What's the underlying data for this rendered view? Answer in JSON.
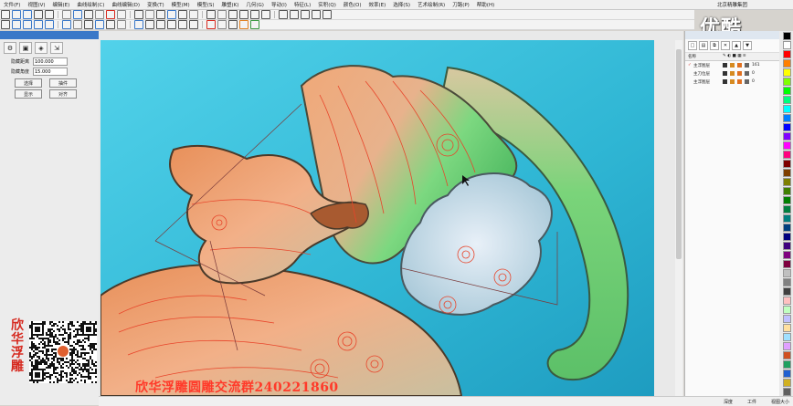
{
  "menu": [
    "文件(F)",
    "视图(V)",
    "编辑(E)",
    "曲线绘制(C)",
    "曲线编辑(D)",
    "变换(T)",
    "模型(M)",
    "模型(S)",
    "雕塑(K)",
    "几何(G)",
    "导动(I)",
    "特征(L)",
    "实积(Q)",
    "颜色(O)",
    "效率(E)",
    "选择(S)",
    "艺术绘制(R)",
    "刀路(P)",
    "帮助(H)"
  ],
  "company": "北京精雕集团",
  "left_panel": {
    "fields": [
      {
        "label": "隐藏距离",
        "value": "100.000"
      },
      {
        "label": "隐藏角度",
        "value": "15.000"
      }
    ],
    "buttons_row1": [
      "选择",
      "抽件"
    ],
    "buttons_row2": [
      "显示",
      "对齐"
    ]
  },
  "qr_text": "欣华浮雕",
  "watermark": "欣华浮雕圆雕交流群240221860",
  "logo": "优酷",
  "layers": {
    "header": [
      "名称",
      "",
      "",
      "",
      "",
      ""
    ],
    "rows": [
      {
        "checked": "✓",
        "name": "主浮图层",
        "count": "161"
      },
      {
        "checked": "",
        "name": "主刀位层",
        "count": "0"
      },
      {
        "checked": "",
        "name": "主浮图层",
        "count": "0"
      }
    ]
  },
  "status": [
    "深度",
    "工件",
    "视图大小"
  ],
  "colors": {
    "accent": "#3a78c8",
    "palette": [
      "#000000",
      "#ffffff",
      "#ff0000",
      "#ff7f00",
      "#ffff00",
      "#7fff00",
      "#00ff00",
      "#00ff7f",
      "#00ffff",
      "#007fff",
      "#0000ff",
      "#7f00ff",
      "#ff00ff",
      "#ff007f",
      "#7f0000",
      "#7f3f00",
      "#7f7f00",
      "#3f7f00",
      "#007f00",
      "#007f3f",
      "#007f7f",
      "#003f7f",
      "#00007f",
      "#3f007f",
      "#7f007f",
      "#7f003f",
      "#c0c0c0",
      "#808080",
      "#404040",
      "#ffc0c0",
      "#c0ffc0",
      "#c0c0ff",
      "#ffe0a0",
      "#a0e0ff",
      "#e0a0ff",
      "#d05020",
      "#20a060",
      "#2060d0",
      "#d0b020",
      "#606060"
    ]
  }
}
